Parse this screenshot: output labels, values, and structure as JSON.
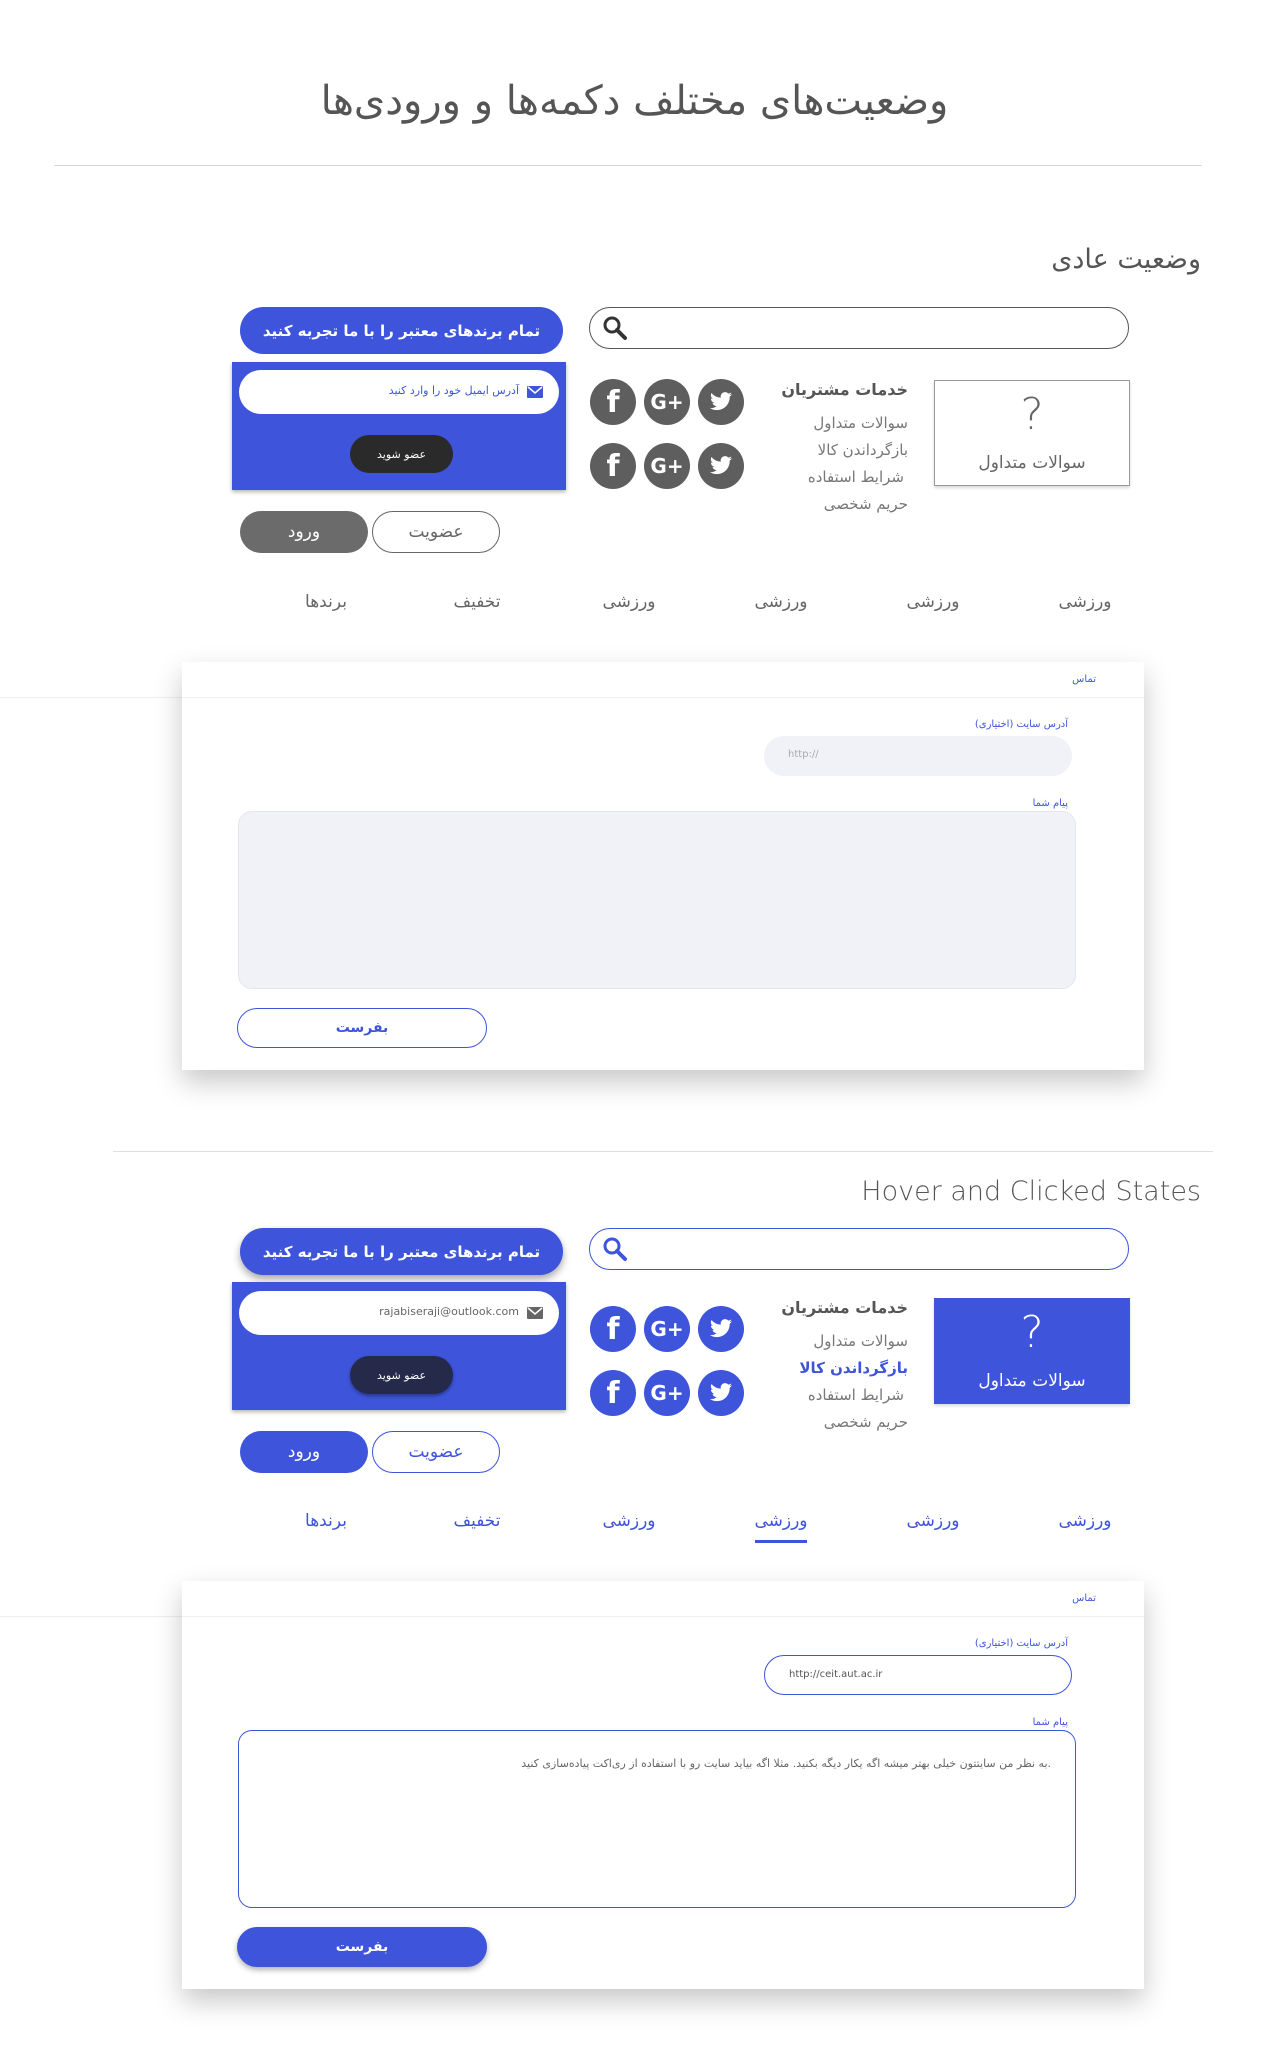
{
  "page_title": "وضعیت‌های مختلف دکمه‌ها و ورودی‌ها",
  "colors": {
    "accent": "#3d54db",
    "dark_gray": "#5e5e5e",
    "dark_button": "#2a2a2a"
  },
  "normal": {
    "title": "وضعیت عادی",
    "cta_label": "تمام برندهای معتبر را با ما تجربه کنید",
    "email_placeholder": "آدرس ایمیل خود را وارد کنید",
    "join_label": "عضو شوید",
    "login_label": "ورود",
    "signup_label": "عضویت",
    "links_title": "خدمات مشتریان",
    "links": [
      "سوالات متداول",
      "بازگرداندن کالا",
      "شرایط استفاده",
      "حریم شخصی"
    ],
    "faq_symbol": "?",
    "faq_label": "سوالات متداول",
    "nav": [
      "ورزشی",
      "ورزشی",
      "ورزشی",
      "ورزشی",
      "تخفیف",
      "برندها"
    ],
    "contact_title": "تماس",
    "url_label": "آدرس سایت (اختیاری)",
    "url_placeholder": "http://",
    "message_label": "پیام شما",
    "send_label": "بفرست"
  },
  "hover": {
    "title": "Hover and Clicked States",
    "cta_label": "تمام برندهای معتبر را با ما تجربه کنید",
    "email_value": "rajabiseraji@outlook.com",
    "join_label": "عضو شوید",
    "login_label": "ورود",
    "signup_label": "عضویت",
    "links_title": "خدمات مشتریان",
    "links": [
      "سوالات متداول",
      "بازگرداندن کالا",
      "شرایط استفاده",
      "حریم شخصی"
    ],
    "faq_symbol": "?",
    "faq_label": "سوالات متداول",
    "nav": [
      "ورزشی",
      "ورزشی",
      "ورزشی",
      "ورزشی",
      "تخفیف",
      "برندها"
    ],
    "contact_title": "تماس",
    "url_label": "آدرس سایت (اختیاری)",
    "url_value": "http://ceit.aut.ac.ir",
    "message_label": "پیام شما",
    "message_value": ".به نظر من سایتتون خیلی بهتر میشه اگه یکار دیگه بکنید. مثلا اگه بیاید سایت رو با استفاده از ری‌اکت پیاده‌سازی کنید",
    "send_label": "بفرست"
  }
}
